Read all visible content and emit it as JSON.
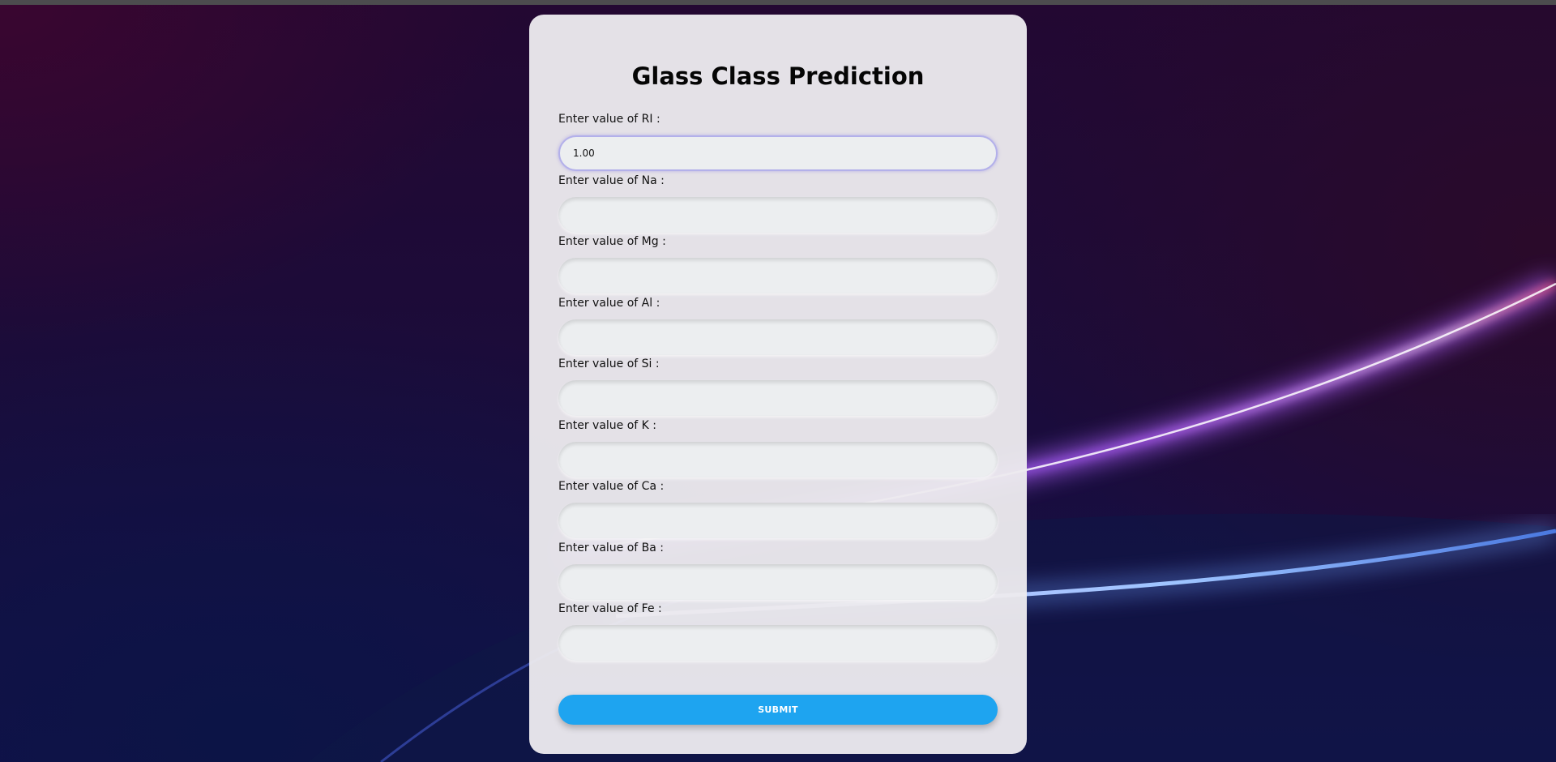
{
  "page": {
    "title": "Glass Class Prediction"
  },
  "colors": {
    "submit_background": "#1ea4f0",
    "card_background": "#eceaee",
    "focus_border": "#b3b0ea"
  },
  "form": {
    "fields": [
      {
        "label": "Enter value of RI :",
        "value": "1.00",
        "placeholder": ""
      },
      {
        "label": "Enter value of Na :",
        "value": "",
        "placeholder": ""
      },
      {
        "label": "Enter value of Mg :",
        "value": "",
        "placeholder": ""
      },
      {
        "label": "Enter value of Al :",
        "value": "",
        "placeholder": ""
      },
      {
        "label": "Enter value of Si :",
        "value": "",
        "placeholder": ""
      },
      {
        "label": "Enter value of K :",
        "value": "",
        "placeholder": ""
      },
      {
        "label": "Enter value of Ca :",
        "value": "",
        "placeholder": ""
      },
      {
        "label": "Enter value of Ba :",
        "value": "",
        "placeholder": ""
      },
      {
        "label": "Enter value of Fe :",
        "value": "",
        "placeholder": ""
      }
    ],
    "submit_label": "SUBMIT"
  }
}
